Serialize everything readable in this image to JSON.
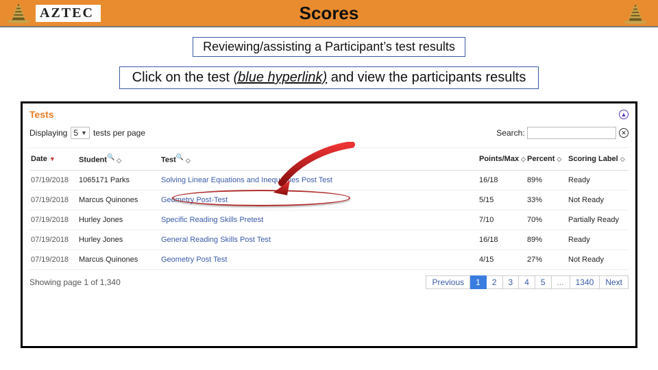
{
  "header": {
    "brand": "AZTEC",
    "title": "Scores"
  },
  "caption": "Reviewing/assisting a Participant’s test results",
  "instruction": {
    "pre": "Click on the test ",
    "emph": "(blue hyperlink)",
    "post": " and view the participants results"
  },
  "panel": {
    "title": "Tests",
    "displaying_label": "Displaying",
    "per_page_value": "5",
    "per_page_suffix": "tests per page",
    "search_label": "Search:",
    "search_value": ""
  },
  "columns": {
    "date": "Date",
    "student": "Student",
    "test": "Test",
    "points": "Points/Max",
    "percent": "Percent",
    "label": "Scoring Label"
  },
  "rows": [
    {
      "date": "07/19/2018",
      "student": "1065171 Parks",
      "test": "Solving Linear Equations and Inequalities Post Test",
      "points": "16/18",
      "percent": "89%",
      "label": "Ready"
    },
    {
      "date": "07/19/2018",
      "student": "Marcus Quinones",
      "test": "Geometry Post-Test",
      "points": "5/15",
      "percent": "33%",
      "label": "Not Ready"
    },
    {
      "date": "07/19/2018",
      "student": "Hurley Jones",
      "test": "Specific Reading Skills Pretest",
      "points": "7/10",
      "percent": "70%",
      "label": "Partially Ready"
    },
    {
      "date": "07/19/2018",
      "student": "Hurley Jones",
      "test": "General Reading Skills Post Test",
      "points": "16/18",
      "percent": "89%",
      "label": "Ready"
    },
    {
      "date": "07/19/2018",
      "student": "Marcus Quinones",
      "test": "Geometry Post Test",
      "points": "4/15",
      "percent": "27%",
      "label": "Not Ready"
    }
  ],
  "footer": {
    "showing": "Showing page 1 of 1,340",
    "prev": "Previous",
    "pages": [
      "1",
      "2",
      "3",
      "4",
      "5",
      "...",
      "1340"
    ],
    "active_page": "1",
    "next": "Next"
  }
}
